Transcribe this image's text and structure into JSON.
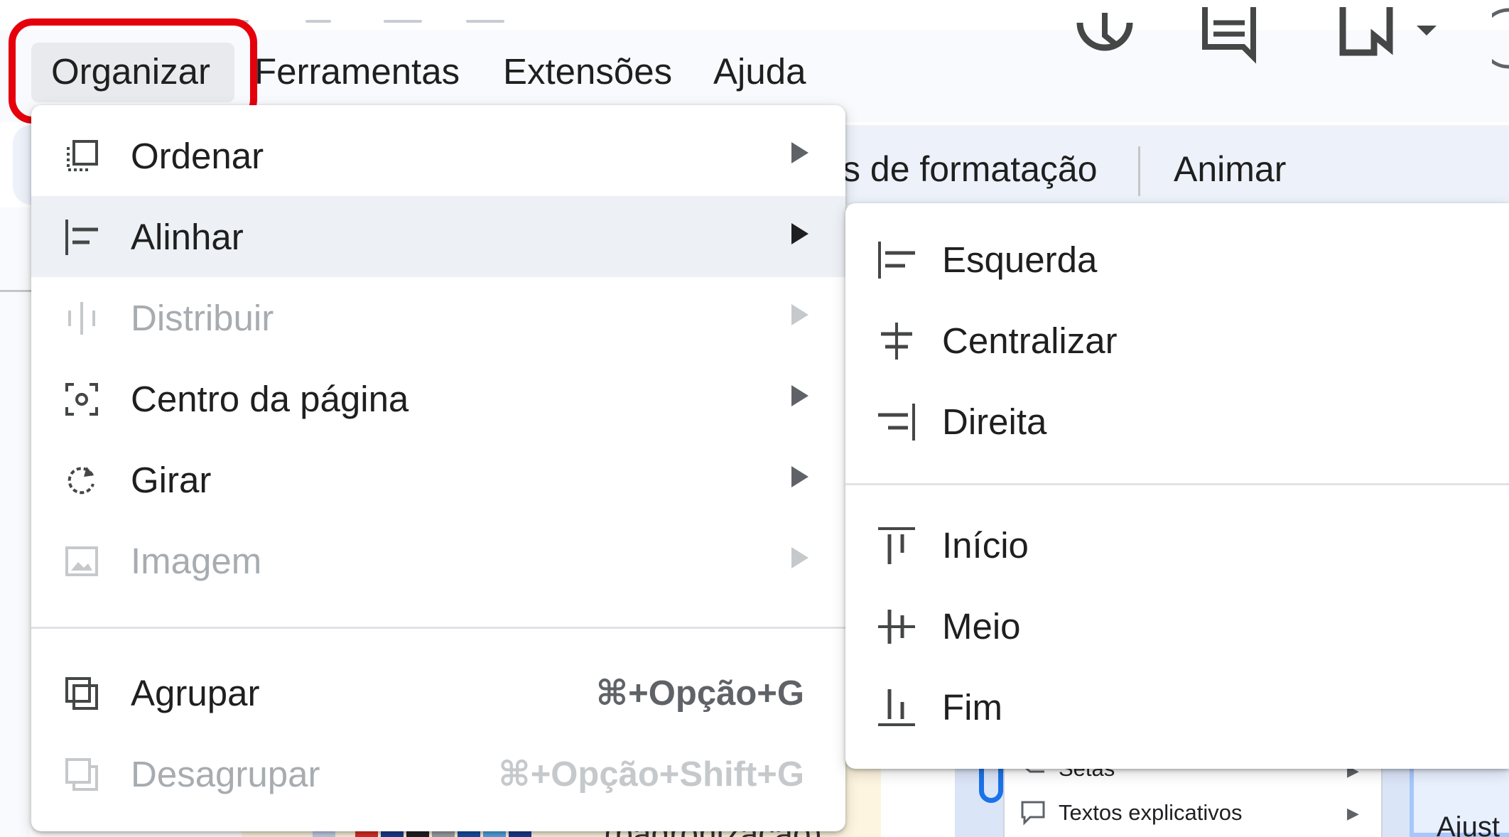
{
  "menubar": {
    "items": [
      "Organizar",
      "Ferramentas",
      "Extensões",
      "Ajuda"
    ]
  },
  "toolbar": {
    "format_options_partial": "s de formatação",
    "animate": "Animar"
  },
  "arrange_menu": {
    "items": [
      {
        "label": "Ordenar",
        "icon": "order-icon",
        "submenu": true,
        "disabled": false
      },
      {
        "label": "Alinhar",
        "icon": "align-left-icon",
        "submenu": true,
        "disabled": false,
        "hovered": true
      },
      {
        "label": "Distribuir",
        "icon": "distribute-icon",
        "submenu": true,
        "disabled": true
      },
      {
        "label": "Centro da página",
        "icon": "center-page-icon",
        "submenu": true,
        "disabled": false
      },
      {
        "label": "Girar",
        "icon": "rotate-icon",
        "submenu": true,
        "disabled": false
      },
      {
        "label": "Imagem",
        "icon": "image-icon",
        "submenu": true,
        "disabled": true
      },
      {
        "label": "Agrupar",
        "icon": "group-icon",
        "shortcut": "⌘+Opção+G",
        "disabled": false
      },
      {
        "label": "Desagrupar",
        "icon": "ungroup-icon",
        "shortcut": "⌘+Opção+Shift+G",
        "disabled": true
      }
    ]
  },
  "align_submenu": {
    "horizontal": [
      {
        "label": "Esquerda",
        "icon": "align-left-icon"
      },
      {
        "label": "Centralizar",
        "icon": "align-center-icon"
      },
      {
        "label": "Direita",
        "icon": "align-right-icon"
      }
    ],
    "vertical": [
      {
        "label": "Início",
        "icon": "align-top-icon"
      },
      {
        "label": "Meio",
        "icon": "align-middle-icon"
      },
      {
        "label": "Fim",
        "icon": "align-bottom-icon"
      }
    ]
  },
  "background_panel": {
    "items": [
      "Setas",
      "Textos explicativos"
    ],
    "canvas_text": "(padronização)",
    "right_text": "Ajust"
  },
  "colors": {
    "highlight_box": "#e5000c",
    "menu_hover": "#edf0f4",
    "disabled_text": "#a7acb1",
    "toolbar_bg": "#edf2fa",
    "accent_blue": "#1a73e8"
  }
}
